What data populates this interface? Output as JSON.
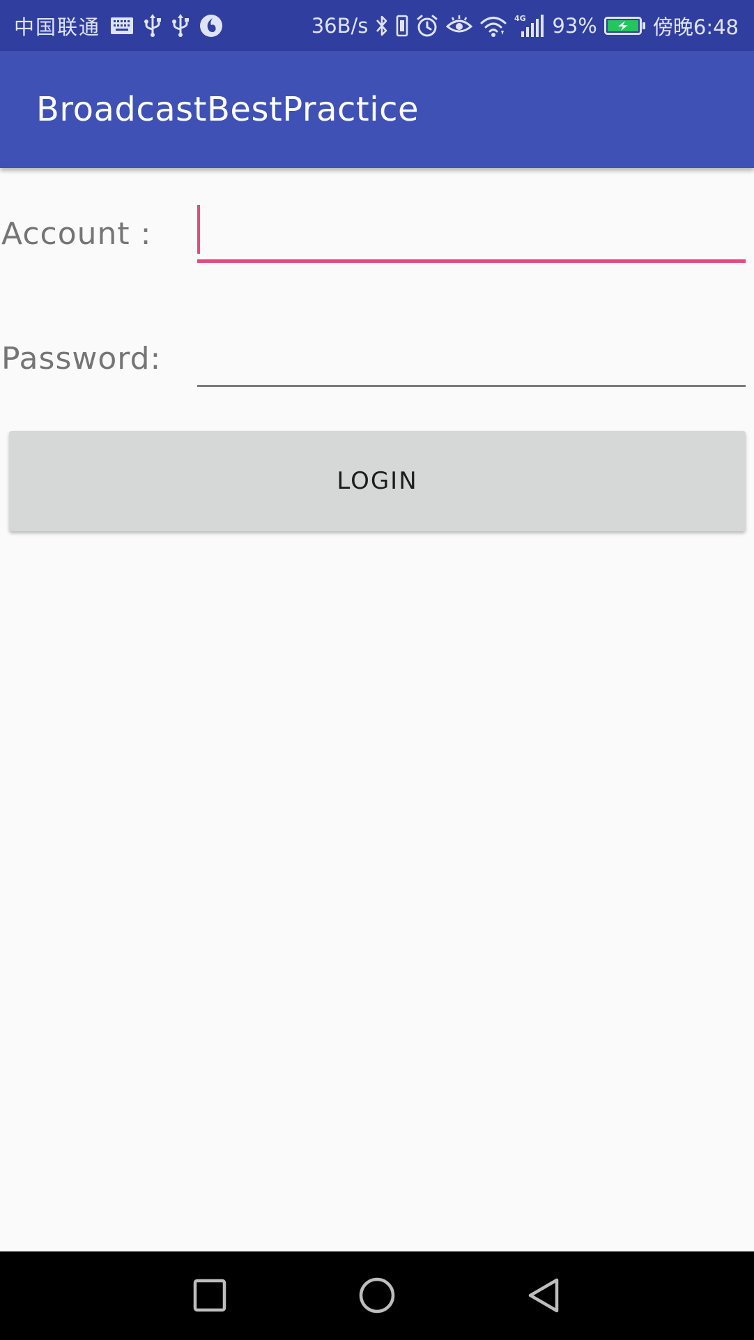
{
  "status_bar": {
    "carrier": "中国联通",
    "net_speed": "36B/s",
    "network_type": "4G",
    "battery_percent": "93%",
    "time": "傍晚6:48",
    "icons": [
      "keyboard-icon",
      "usb-icon",
      "usb-icon",
      "app-notification-icon",
      "bluetooth-icon",
      "vibrate-icon",
      "alarm-icon",
      "eye-comfort-icon",
      "wifi-icon",
      "signal-icon",
      "battery-charging-icon"
    ],
    "colors": {
      "background": "#303f9f",
      "foreground": "#dfe3f6",
      "battery_fill": "#22c55e"
    }
  },
  "app_bar": {
    "title": "BroadcastBestPractice",
    "color": "#3f51b5"
  },
  "form": {
    "account_label": "Account :",
    "account_value": "",
    "account_placeholder": "",
    "password_label": "Password:",
    "password_value": "",
    "password_placeholder": "",
    "focused_field": "account",
    "accent_color": "#e8487f"
  },
  "login_button": {
    "label": "LOGIN"
  },
  "nav_bar": {
    "buttons": [
      "recents-square-icon",
      "home-circle-icon",
      "back-triangle-icon"
    ]
  }
}
